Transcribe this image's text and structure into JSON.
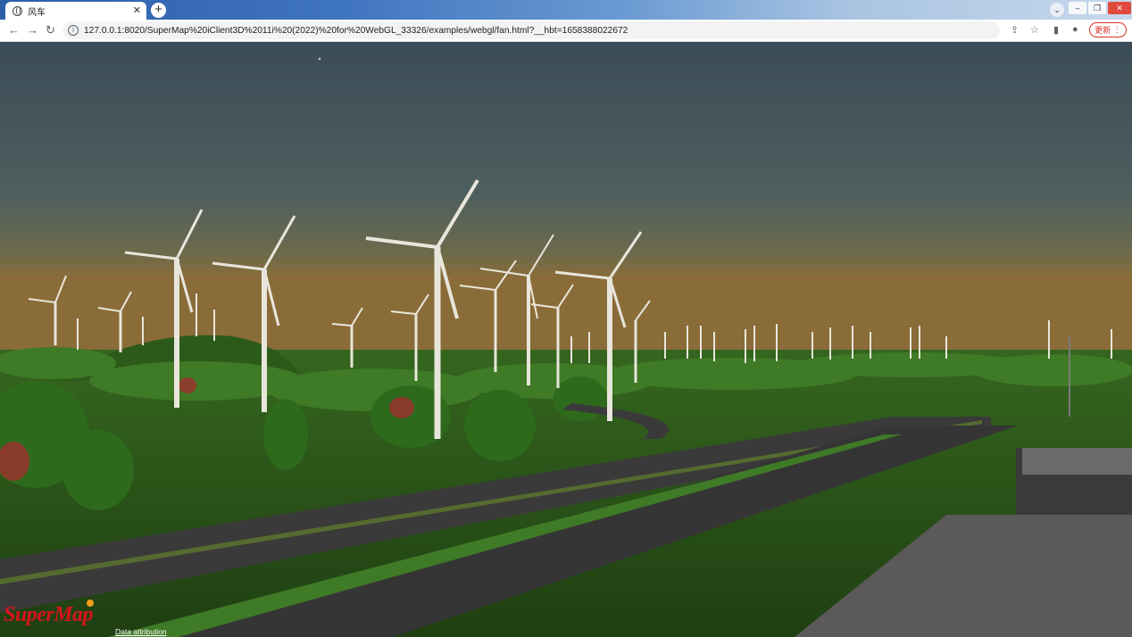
{
  "browser": {
    "tab_title": "风车",
    "tab_close": "✕",
    "new_tab": "+",
    "url": "127.0.0.1:8020/SuperMap%20iClient3D%2011i%20(2022)%20for%20WebGL_33326/examples/webgl/fan.html?__hbt=1658388022672",
    "update_label": "更新",
    "menu_glyph": "⋮",
    "back_glyph": "←",
    "forward_glyph": "→",
    "reload_glyph": "↻",
    "share_glyph": "⇪",
    "star_glyph": "☆",
    "dropdown_glyph": "⌄",
    "win_min": "–",
    "win_max": "❐",
    "win_close": "✕"
  },
  "scene": {
    "description_icon": "wind-farm-3d-scene",
    "sky_top": "#3d4f5a",
    "sky_horizon": "#8a6a3a",
    "grass": "#2f5a1c",
    "road": "#3a3a3a"
  },
  "footer": {
    "logo_text": "SuperMap",
    "attribution": "Data attribution"
  }
}
